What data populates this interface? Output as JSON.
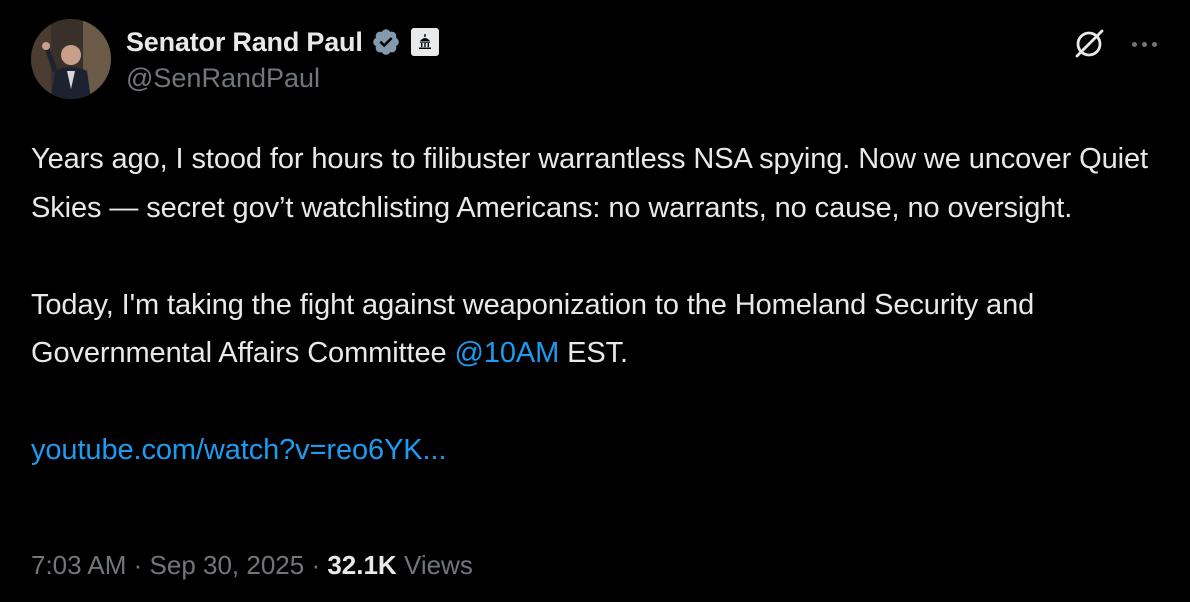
{
  "author": {
    "display_name": "Senator Rand Paul",
    "handle": "@SenRandPaul",
    "verified_color": "#829aab"
  },
  "icons": {
    "avatar": "profile-photo",
    "verified": "verified-badge-icon",
    "affiliation": "government-building-icon",
    "grok": "grok-icon",
    "more": "more-options-icon"
  },
  "tweet": {
    "p1": "Years ago, I stood for hours to filibuster warrantless NSA spying. Now we uncover Quiet Skies — secret gov’t watchlisting Americans: no warrants, no cause, no oversight.",
    "p2_before": "Today, I'm taking the fight against weaponization to the Homeland Security and Governmental Affairs Committee ",
    "p2_mention": "@10AM",
    "p2_after": " EST.",
    "link": "youtube.com/watch?v=reo6YK..."
  },
  "meta": {
    "time": "7:03 AM",
    "sep1": " · ",
    "date": "Sep 30, 2025",
    "sep2": " · ",
    "views_count": "32.1K",
    "views_label": " Views"
  },
  "colors": {
    "background": "#000000",
    "text": "#e7e9ea",
    "secondary": "#71767b",
    "link": "#1d9bf0"
  }
}
